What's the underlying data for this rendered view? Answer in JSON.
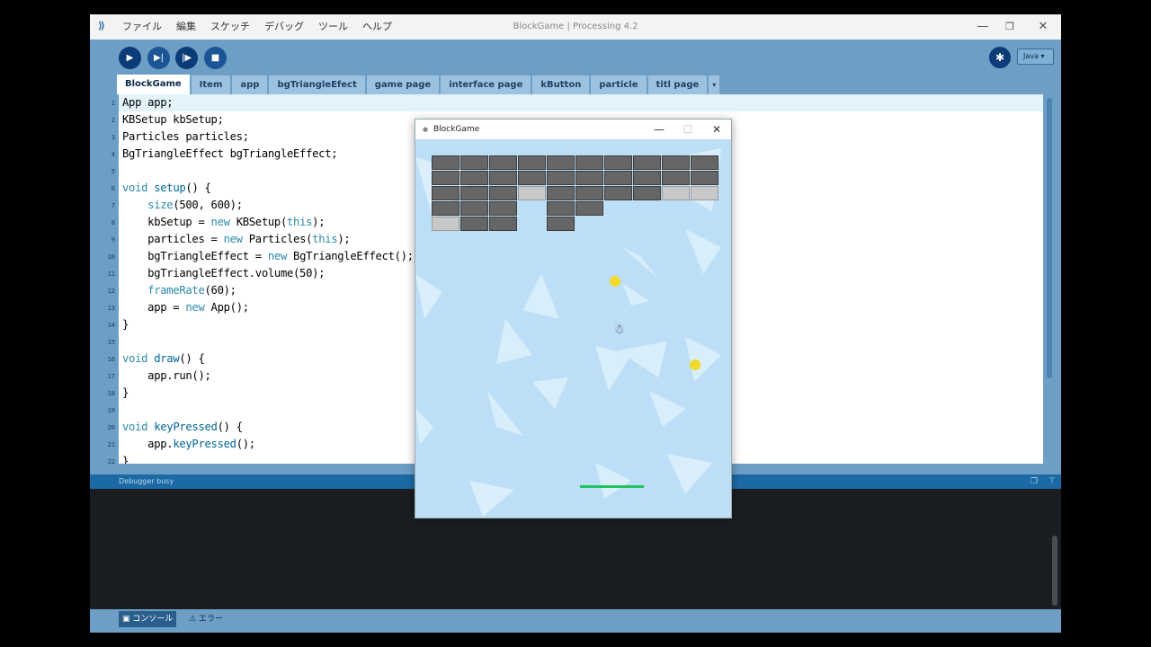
{
  "window": {
    "title": "BlockGame | Processing 4.2",
    "menu": [
      "ファイル",
      "編集",
      "スケッチ",
      "デバッグ",
      "ツール",
      "ヘルプ"
    ],
    "controls": {
      "minimize": "—",
      "maximize": "❐",
      "close": "✕"
    }
  },
  "toolbar": {
    "run_icon": "play-icon",
    "step_icon": "step-icon",
    "continue_icon": "continue-icon",
    "stop_icon": "stop-icon",
    "mode": "Java ▾"
  },
  "tabs": [
    {
      "label": "BlockGame",
      "active": true
    },
    {
      "label": "Item"
    },
    {
      "label": "app"
    },
    {
      "label": "bgTriangleEfect"
    },
    {
      "label": "game page"
    },
    {
      "label": "interface page"
    },
    {
      "label": "kButton"
    },
    {
      "label": "particle"
    },
    {
      "label": "titl page"
    },
    {
      "label": "▾"
    }
  ],
  "editor": {
    "line_numbers": [
      "1",
      "2",
      "3",
      "4",
      "5",
      "6",
      "7",
      "8",
      "9",
      "10",
      "11",
      "12",
      "13",
      "14",
      "15",
      "16",
      "17",
      "18",
      "19",
      "20",
      "21",
      "22"
    ],
    "lines": [
      [
        {
          "t": "App app;"
        }
      ],
      [
        {
          "t": "KBSetup kbSetup;"
        }
      ],
      [
        {
          "t": "Particles particles;"
        }
      ],
      [
        {
          "t": "BgTriangleEffect bgTriangleEffect;"
        }
      ],
      [],
      [
        {
          "t": "void",
          "c": "kw"
        },
        {
          "t": " "
        },
        {
          "t": "setup",
          "c": "fn"
        },
        {
          "t": "() {"
        }
      ],
      [
        {
          "t": "    "
        },
        {
          "t": "size",
          "c": "kw"
        },
        {
          "t": "(500, 600);"
        }
      ],
      [
        {
          "t": "    kbSetup = "
        },
        {
          "t": "new",
          "c": "kw"
        },
        {
          "t": " KBSetup("
        },
        {
          "t": "this",
          "c": "kw"
        },
        {
          "t": ");"
        }
      ],
      [
        {
          "t": "    particles = "
        },
        {
          "t": "new",
          "c": "kw"
        },
        {
          "t": " Particles("
        },
        {
          "t": "this",
          "c": "kw"
        },
        {
          "t": ");"
        }
      ],
      [
        {
          "t": "    bgTriangleEffect = "
        },
        {
          "t": "new",
          "c": "kw"
        },
        {
          "t": " BgTriangleEffect();"
        }
      ],
      [
        {
          "t": "    bgTriangleEffect.volume(50);"
        }
      ],
      [
        {
          "t": "    "
        },
        {
          "t": "frameRate",
          "c": "kw"
        },
        {
          "t": "(60);"
        }
      ],
      [
        {
          "t": "    app = "
        },
        {
          "t": "new",
          "c": "kw"
        },
        {
          "t": " App();"
        }
      ],
      [
        {
          "t": "}"
        }
      ],
      [],
      [
        {
          "t": "void",
          "c": "kw"
        },
        {
          "t": " "
        },
        {
          "t": "draw",
          "c": "fn"
        },
        {
          "t": "() {"
        }
      ],
      [
        {
          "t": "    app.run();"
        }
      ],
      [
        {
          "t": "}"
        }
      ],
      [],
      [
        {
          "t": "void",
          "c": "kw"
        },
        {
          "t": " "
        },
        {
          "t": "keyPressed",
          "c": "fn"
        },
        {
          "t": "() {"
        }
      ],
      [
        {
          "t": "    app."
        },
        {
          "t": "keyPressed",
          "c": "fn"
        },
        {
          "t": "();"
        }
      ],
      [
        {
          "t": "}"
        }
      ]
    ]
  },
  "status": {
    "text": "Debugger busy"
  },
  "console_tabs": [
    {
      "icon": "console-icon",
      "label": "コンソール",
      "active": true
    },
    {
      "icon": "warning-icon",
      "label": "エラー"
    }
  ],
  "sketch_window": {
    "title": "BlockGame",
    "controls": {
      "minimize": "—",
      "maximize": "☐",
      "close": "✕"
    },
    "brick_rows": [
      [
        "n",
        "n",
        "n",
        "n",
        "n",
        "n",
        "n",
        "n",
        "n",
        "n"
      ],
      [
        "n",
        "n",
        "n",
        "n",
        "n",
        "n",
        "n",
        "n",
        "n",
        "n"
      ],
      [
        "n",
        "n",
        "n",
        "h",
        "n",
        "n",
        "n",
        "n",
        "h",
        "h"
      ],
      [
        "n",
        "n",
        "n",
        "-",
        "n",
        "n",
        "-",
        "-",
        "-",
        "-"
      ],
      [
        "h",
        "n",
        "n",
        "-",
        "n",
        "-",
        "-",
        "-",
        "-",
        "-"
      ]
    ]
  }
}
